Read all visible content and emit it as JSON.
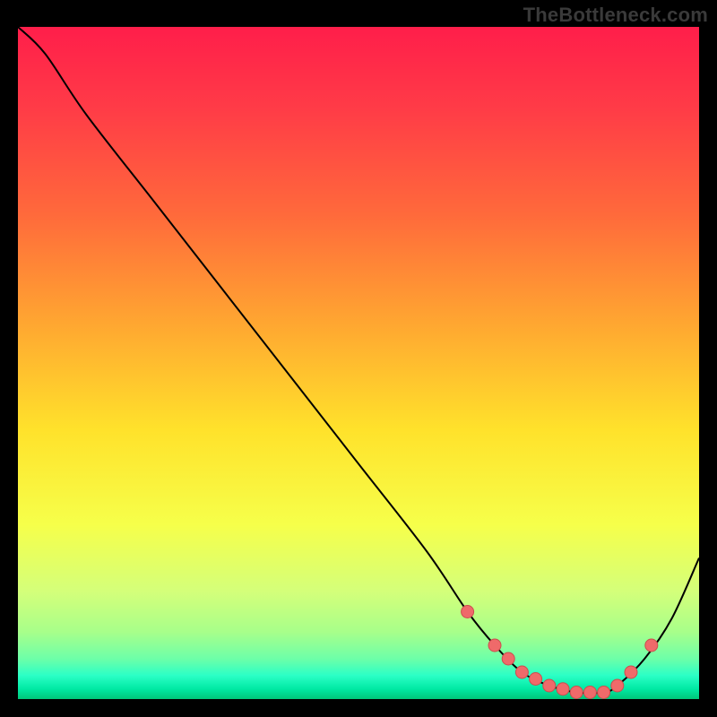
{
  "watermark": "TheBottleneck.com",
  "chart_data": {
    "type": "line",
    "title": "",
    "xlabel": "",
    "ylabel": "",
    "xlim": [
      0,
      100
    ],
    "ylim": [
      0,
      100
    ],
    "series": [
      {
        "name": "curve",
        "x": [
          0,
          4,
          10,
          20,
          30,
          40,
          50,
          60,
          66,
          70,
          74,
          78,
          82,
          86,
          88,
          92,
          96,
          100
        ],
        "y": [
          100,
          96,
          87,
          74,
          61,
          48,
          35,
          22,
          13,
          8,
          4,
          2,
          1,
          1,
          2,
          6,
          12,
          21
        ]
      }
    ],
    "highlight_points": {
      "name": "bottom-cluster",
      "x": [
        66,
        70,
        72,
        74,
        76,
        78,
        80,
        82,
        84,
        86,
        88,
        90,
        93
      ],
      "y": [
        13,
        8,
        6,
        4,
        3,
        2,
        1.5,
        1,
        1,
        1,
        2,
        4,
        8
      ]
    },
    "colors": {
      "curve": "#000000",
      "points_fill": "#ef6a6a",
      "points_stroke": "#cc4d4d"
    },
    "background_gradient": {
      "stops": [
        {
          "offset": 0.0,
          "color": "#ff1e4a"
        },
        {
          "offset": 0.12,
          "color": "#ff3b47"
        },
        {
          "offset": 0.28,
          "color": "#ff6a3b"
        },
        {
          "offset": 0.44,
          "color": "#ffa631"
        },
        {
          "offset": 0.6,
          "color": "#ffe22b"
        },
        {
          "offset": 0.74,
          "color": "#f6ff4a"
        },
        {
          "offset": 0.84,
          "color": "#d4ff7a"
        },
        {
          "offset": 0.9,
          "color": "#a8ff8a"
        },
        {
          "offset": 0.94,
          "color": "#6dffa8"
        },
        {
          "offset": 0.965,
          "color": "#2bffc6"
        },
        {
          "offset": 0.985,
          "color": "#00e9a3"
        },
        {
          "offset": 1.0,
          "color": "#00c679"
        }
      ]
    }
  }
}
